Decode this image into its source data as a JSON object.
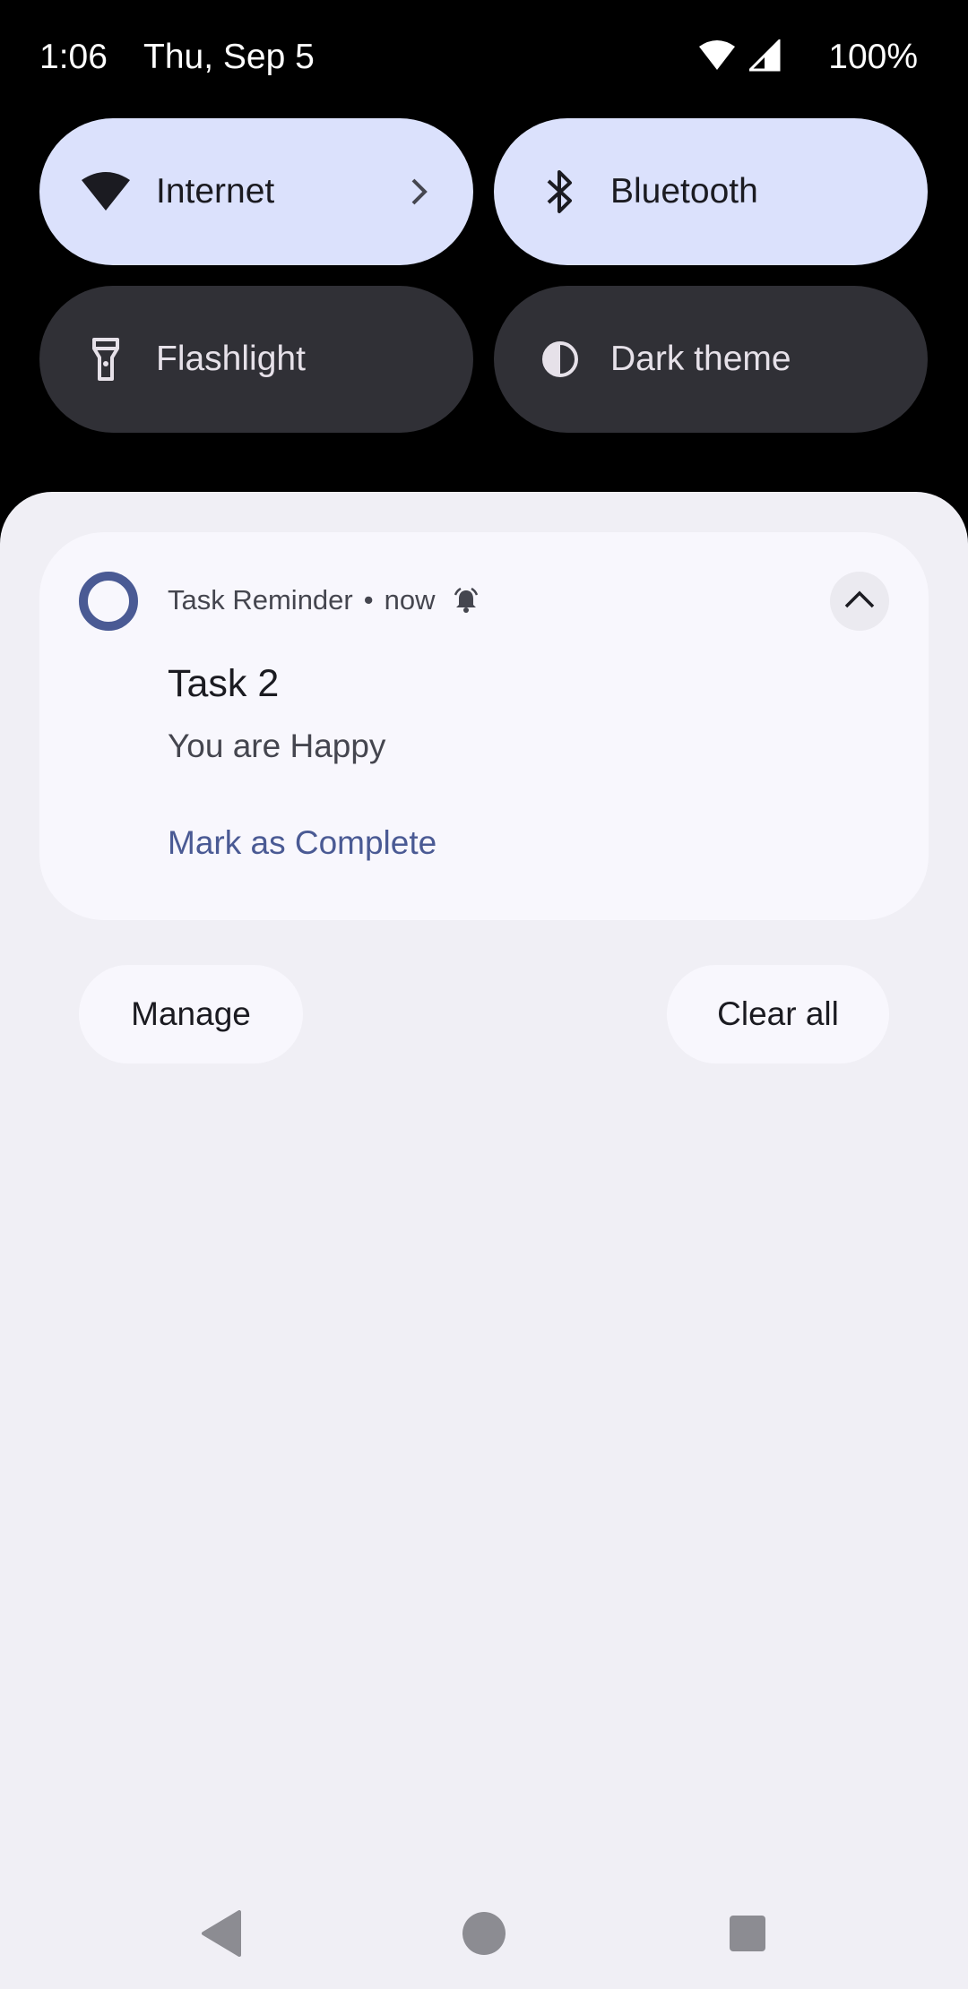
{
  "status_bar": {
    "time": "1:06",
    "date": "Thu, Sep 5",
    "battery": "100%",
    "icons": [
      "wifi-icon",
      "cell-signal-icon"
    ]
  },
  "quick_settings": {
    "tiles": [
      {
        "label": "Internet",
        "icon": "wifi-icon",
        "state": "on",
        "has_chevron": true
      },
      {
        "label": "Bluetooth",
        "icon": "bluetooth-icon",
        "state": "on"
      },
      {
        "label": "Flashlight",
        "icon": "flashlight-icon",
        "state": "off"
      },
      {
        "label": "Dark theme",
        "icon": "dark-theme-icon",
        "state": "off"
      }
    ]
  },
  "notification": {
    "app_name": "Task Reminder",
    "separator": "•",
    "time": "now",
    "title": "Task 2",
    "text": "You are Happy",
    "action": "Mark as Complete",
    "accent_color": "#4a5a94"
  },
  "shade_actions": {
    "manage": "Manage",
    "clear_all": "Clear all"
  },
  "colors": {
    "tile_on": "#dbe1fc",
    "tile_off": "#303036",
    "shade_bg": "#f0eff5",
    "card_bg": "#f8f7fd"
  }
}
